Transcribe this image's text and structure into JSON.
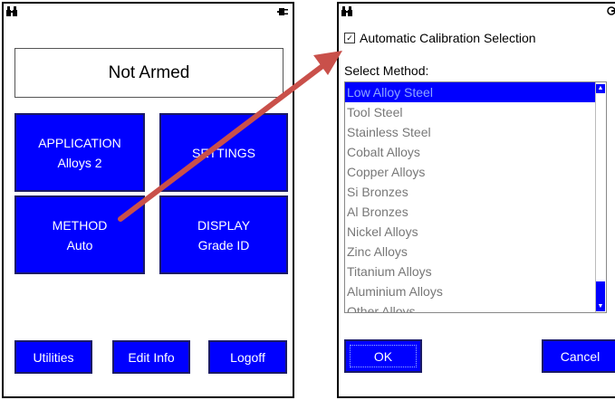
{
  "left": {
    "status": "Not Armed",
    "tiles": {
      "application": {
        "line1": "APPLICATION",
        "line2": "Alloys 2"
      },
      "settings": {
        "line1": "SETTINGS"
      },
      "method": {
        "line1": "METHOD",
        "line2": "Auto"
      },
      "display": {
        "line1": "DISPLAY",
        "line2": "Grade ID"
      }
    },
    "bottom": {
      "utilities": "Utilities",
      "edit_info": "Edit Info",
      "logoff": "Logoff"
    },
    "icons": {
      "top_left": "binoculars-icon",
      "top_right": "power-plug-icon"
    }
  },
  "right": {
    "auto_calibration_label": "Automatic Calibration Selection",
    "auto_calibration_checked": true,
    "select_method_label": "Select Method:",
    "methods": [
      "Low Alloy Steel",
      "Tool Steel",
      "Stainless Steel",
      "Cobalt Alloys",
      "Copper Alloys",
      "Si Bronzes",
      "Al Bronzes",
      "Nickel Alloys",
      "Zinc Alloys",
      "Titanium Alloys",
      "Aluminium Alloys",
      "Other Alloys"
    ],
    "selected_method": "Low Alloy Steel",
    "ok_label": "OK",
    "cancel_label": "Cancel"
  },
  "colors": {
    "button_blue": "#0000ff",
    "arrow": "#c9504a"
  }
}
